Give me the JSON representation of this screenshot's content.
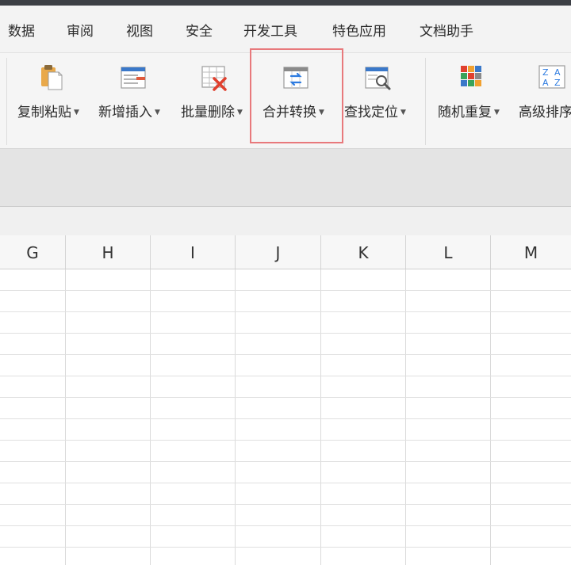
{
  "menu": {
    "items": [
      "数据",
      "审阅",
      "视图",
      "安全",
      "开发工具",
      "特色应用",
      "文档助手"
    ]
  },
  "ribbon": {
    "buttons": [
      {
        "label": "复制粘贴",
        "icon": "clipboard-paste-icon"
      },
      {
        "label": "新增插入",
        "icon": "insert-row-icon"
      },
      {
        "label": "批量删除",
        "icon": "table-delete-icon"
      },
      {
        "label": "合并转换",
        "icon": "merge-convert-icon"
      },
      {
        "label": "查找定位",
        "icon": "find-locate-icon"
      },
      {
        "label": "随机重复",
        "icon": "random-repeat-icon"
      },
      {
        "label": "高级排序",
        "icon": "advanced-sort-icon"
      }
    ],
    "highlighted": "合并转换",
    "highlight_color": "#e8797c"
  },
  "sheet": {
    "columns": [
      "G",
      "H",
      "I",
      "J",
      "K",
      "L",
      "M"
    ]
  }
}
